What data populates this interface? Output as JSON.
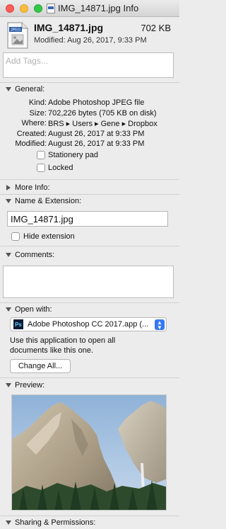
{
  "window": {
    "title": "IMG_14871.jpg Info"
  },
  "header": {
    "file_name": "IMG_14871.jpg",
    "file_size": "702 KB",
    "modified": "Modified: Aug 26, 2017, 9:33 PM",
    "icon_badge": "JPEG"
  },
  "tags": {
    "placeholder": "Add Tags..."
  },
  "general": {
    "label": "General:",
    "rows": [
      {
        "key": "Kind:",
        "value": "Adobe Photoshop JPEG file"
      },
      {
        "key": "Size:",
        "value": "702,226 bytes (705 KB on disk)"
      },
      {
        "key": "Where:",
        "value": "BRS ▸ Users ▸ Gene ▸ Dropbox"
      },
      {
        "key": "Created:",
        "value": "August 26, 2017 at 9:33 PM"
      },
      {
        "key": "Modified:",
        "value": "August 26, 2017 at 9:33 PM"
      }
    ],
    "stationery": "Stationery pad",
    "locked": "Locked"
  },
  "more_info": {
    "label": "More Info:"
  },
  "name_ext": {
    "label": "Name & Extension:",
    "value": "IMG_14871.jpg",
    "hide_extension": "Hide extension"
  },
  "comments": {
    "label": "Comments:"
  },
  "open_with": {
    "label": "Open with:",
    "app": "Adobe Photoshop CC 2017.app (...",
    "app_icon": "Ps",
    "description": "Use this application to open all documents like this one.",
    "change_all": "Change All..."
  },
  "preview": {
    "label": "Preview:"
  },
  "sharing": {
    "label": "Sharing & Permissions:"
  }
}
